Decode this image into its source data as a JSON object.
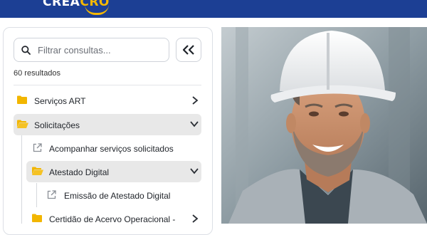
{
  "header": {
    "logo_text": "CREA",
    "logo_accent": "CRO",
    "brand_color": "#1c3f94",
    "accent_color": "#f5b800"
  },
  "sidebar": {
    "search": {
      "placeholder": "Filtrar consultas...",
      "value": ""
    },
    "results_count": "60 resultados",
    "items": [
      {
        "label": "Serviços ART",
        "icon": "folder-icon",
        "expanded": false
      },
      {
        "label": "Solicitações",
        "icon": "folder-open-icon",
        "expanded": true
      },
      {
        "label": "Acompanhar serviços solicitados",
        "icon": "external-link-icon"
      },
      {
        "label": "Atestado Digital",
        "icon": "folder-open-icon",
        "expanded": true
      },
      {
        "label": "Emissão de Atestado Digital",
        "icon": "external-link-icon"
      },
      {
        "label": "Certidão de Acervo Operacional -",
        "icon": "folder-icon",
        "expanded": false
      }
    ]
  },
  "hero": {
    "image": "smiling-engineer-in-white-hard-hat"
  }
}
